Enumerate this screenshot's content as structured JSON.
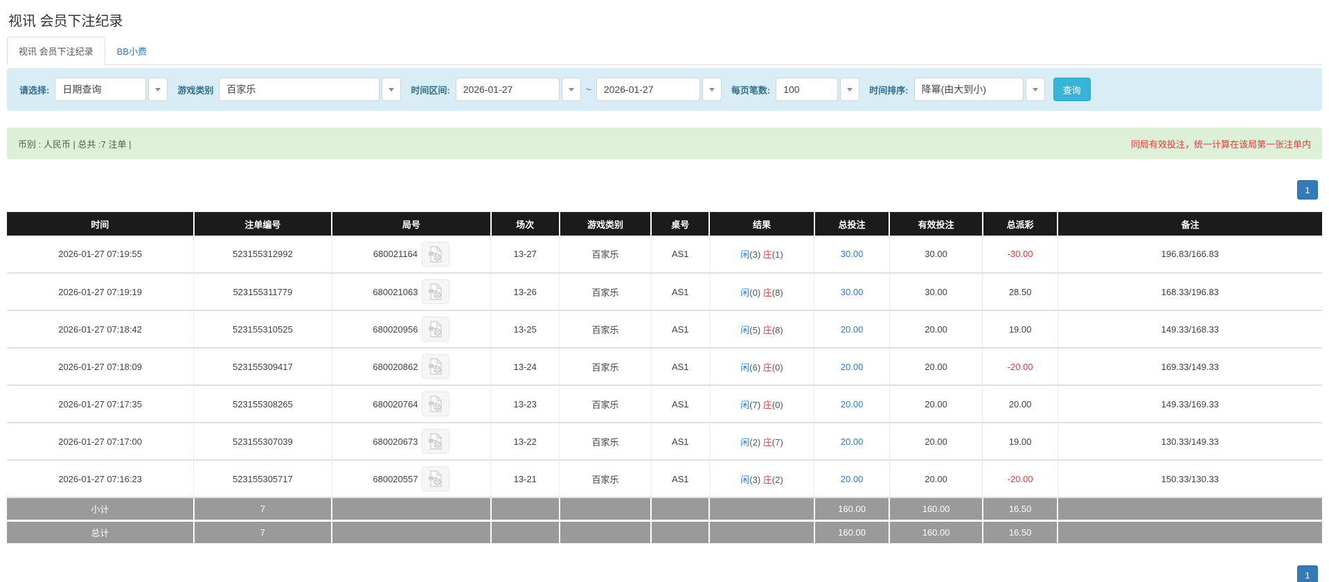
{
  "page": {
    "title": "视讯 会员下注纪录"
  },
  "tabs": [
    {
      "label": "视讯 会员下注纪录",
      "active": true
    },
    {
      "label": "BB小费",
      "active": false
    }
  ],
  "filters": {
    "select_label": "请选择:",
    "select_value": "日期查询",
    "game_label": "游戏类别",
    "game_value": "百家乐",
    "range_label": "时间区间:",
    "date_from": "2026-01-27",
    "tilde": "~",
    "date_to": "2026-01-27",
    "per_page_label": "每页笔数:",
    "per_page_value": "100",
    "sort_label": "时间排序:",
    "sort_value": "降幂(由大到小)",
    "search_button": "查询"
  },
  "summary": {
    "left": "币别 : 人民币 | 总共 :7 注单 |",
    "right": "同局有效投注，统一计算在该局第一张注单内"
  },
  "pagination": {
    "page": "1"
  },
  "icons": {
    "video_replay": "video-replay-icon",
    "dropdown": "dropdown-arrow-icon"
  },
  "colors": {
    "link_blue": "#337ab7",
    "value_blue": "#2e7bcc",
    "negative_red": "#e4393c",
    "header_bg": "#1b1b1b",
    "subtotal_bg": "#9a9a9a",
    "filter_bg": "#d9edf7",
    "summary_bg": "#dff0d8",
    "search_button_bg": "#39b3d7"
  },
  "table": {
    "headers": [
      "时间",
      "注单编号",
      "局号",
      "场次",
      "游戏类别",
      "桌号",
      "结果",
      "总投注",
      "有效投注",
      "总派彩",
      "备注"
    ],
    "rows": [
      {
        "time": "2026-01-27 07:19:55",
        "bet_id": "523155312992",
        "round": "680021164",
        "session": "13-27",
        "game": "百家乐",
        "table_no": "AS1",
        "result": {
          "player": "闲",
          "player_score": "(3)",
          "banker": "庄",
          "banker_score": "(1)"
        },
        "total_bet": "30.00",
        "valid_bet": "30.00",
        "payout": "-30.00",
        "note": "196.83/166.83"
      },
      {
        "time": "2026-01-27 07:19:19",
        "bet_id": "523155311779",
        "round": "680021063",
        "session": "13-26",
        "game": "百家乐",
        "table_no": "AS1",
        "result": {
          "player": "闲",
          "player_score": "(0)",
          "banker": "庄",
          "banker_score": "(8)"
        },
        "total_bet": "30.00",
        "valid_bet": "30.00",
        "payout": "28.50",
        "note": "168.33/196.83"
      },
      {
        "time": "2026-01-27 07:18:42",
        "bet_id": "523155310525",
        "round": "680020956",
        "session": "13-25",
        "game": "百家乐",
        "table_no": "AS1",
        "result": {
          "player": "闲",
          "player_score": "(5)",
          "banker": "庄",
          "banker_score": "(8)"
        },
        "total_bet": "20.00",
        "valid_bet": "20.00",
        "payout": "19.00",
        "note": "149.33/168.33"
      },
      {
        "time": "2026-01-27 07:18:09",
        "bet_id": "523155309417",
        "round": "680020862",
        "session": "13-24",
        "game": "百家乐",
        "table_no": "AS1",
        "result": {
          "player": "闲",
          "player_score": "(6)",
          "banker": "庄",
          "banker_score": "(0)"
        },
        "total_bet": "20.00",
        "valid_bet": "20.00",
        "payout": "-20.00",
        "note": "169.33/149.33"
      },
      {
        "time": "2026-01-27 07:17:35",
        "bet_id": "523155308265",
        "round": "680020764",
        "session": "13-23",
        "game": "百家乐",
        "table_no": "AS1",
        "result": {
          "player": "闲",
          "player_score": "(7)",
          "banker": "庄",
          "banker_score": "(0)"
        },
        "total_bet": "20.00",
        "valid_bet": "20.00",
        "payout": "20.00",
        "note": "149.33/169.33"
      },
      {
        "time": "2026-01-27 07:17:00",
        "bet_id": "523155307039",
        "round": "680020673",
        "session": "13-22",
        "game": "百家乐",
        "table_no": "AS1",
        "result": {
          "player": "闲",
          "player_score": "(2)",
          "banker": "庄",
          "banker_score": "(7)"
        },
        "total_bet": "20.00",
        "valid_bet": "20.00",
        "payout": "19.00",
        "note": "130.33/149.33"
      },
      {
        "time": "2026-01-27 07:16:23",
        "bet_id": "523155305717",
        "round": "680020557",
        "session": "13-21",
        "game": "百家乐",
        "table_no": "AS1",
        "result": {
          "player": "闲",
          "player_score": "(3)",
          "banker": "庄",
          "banker_score": "(2)"
        },
        "total_bet": "20.00",
        "valid_bet": "20.00",
        "payout": "-20.00",
        "note": "150.33/130.33"
      }
    ],
    "subtotal": {
      "label": "小计",
      "count": "7",
      "total_bet": "160.00",
      "valid_bet": "160.00",
      "payout": "16.50"
    },
    "total": {
      "label": "总计",
      "count": "7",
      "total_bet": "160.00",
      "valid_bet": "160.00",
      "payout": "16.50"
    }
  }
}
